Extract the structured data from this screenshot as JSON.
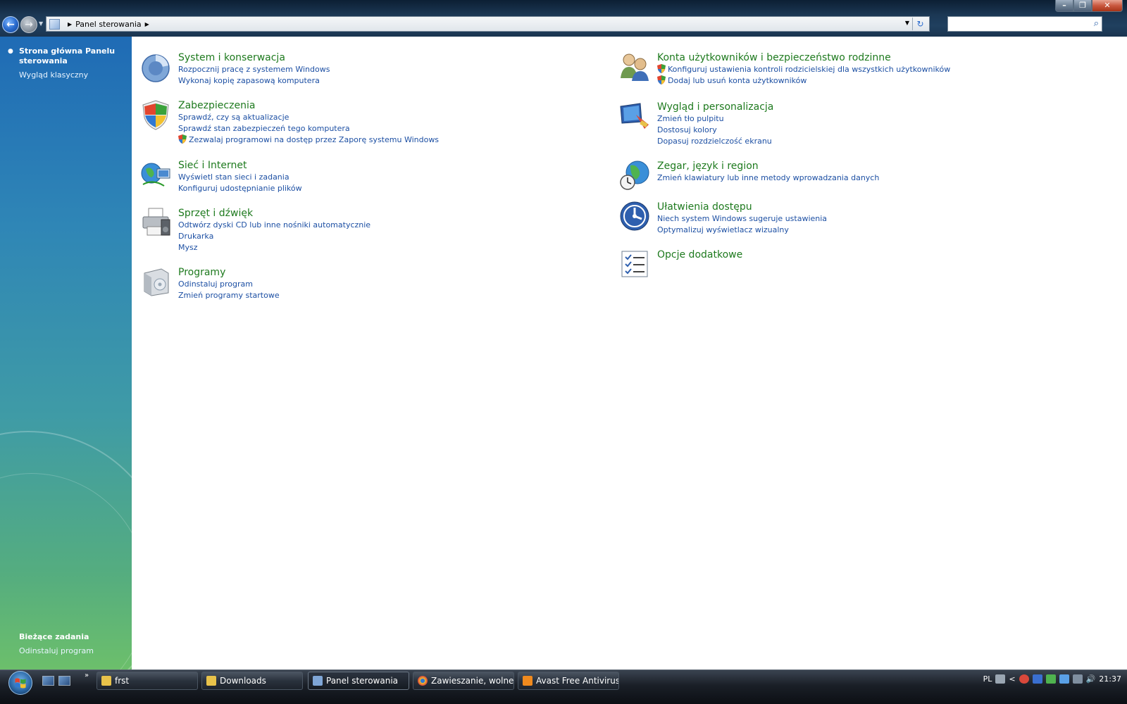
{
  "window": {
    "controls": {
      "minimize": "–",
      "maximize": "❐",
      "close": "✕"
    }
  },
  "addressbar": {
    "crumb": "Panel sterowania",
    "search_placeholder": ""
  },
  "leftpane": {
    "home_link": "Strona główna Panelu sterowania",
    "classic_link": "Wygląd klasyczny",
    "tasks_title": "Bieżące zadania",
    "tasks_link": "Odinstaluj program"
  },
  "categories": {
    "system": {
      "title": "System i konserwacja",
      "links": [
        "Rozpocznij pracę z systemem Windows",
        "Wykonaj kopię zapasową komputera"
      ]
    },
    "security": {
      "title": "Zabezpieczenia",
      "links": [
        "Sprawdź, czy są aktualizacje",
        "Sprawdź stan zabezpieczeń tego komputera",
        "Zezwalaj programowi na dostęp przez Zaporę systemu Windows"
      ]
    },
    "network": {
      "title": "Sieć i Internet",
      "links": [
        "Wyświetl stan sieci i zadania",
        "Konfiguruj udostępnianie plików"
      ]
    },
    "hardware": {
      "title": "Sprzęt i dźwięk",
      "links": [
        "Odtwórz dyski CD lub inne nośniki automatycznie",
        "Drukarka",
        "Mysz"
      ]
    },
    "programs": {
      "title": "Programy",
      "links": [
        "Odinstaluj program",
        "Zmień programy startowe"
      ]
    },
    "users": {
      "title": "Konta użytkowników i bezpieczeństwo rodzinne",
      "links": [
        "Konfiguruj ustawienia kontroli rodzicielskiej dla wszystkich użytkowników",
        "Dodaj lub usuń konta użytkowników"
      ]
    },
    "appearance": {
      "title": "Wygląd i personalizacja",
      "links": [
        "Zmień tło pulpitu",
        "Dostosuj kolory",
        "Dopasuj rozdzielczość ekranu"
      ]
    },
    "clock": {
      "title": "Zegar, język i region",
      "links": [
        "Zmień klawiatury lub inne metody wprowadzania danych"
      ]
    },
    "access": {
      "title": "Ułatwienia dostępu",
      "links": [
        "Niech system Windows sugeruje ustawienia",
        "Optymalizuj wyświetlacz wizualny"
      ]
    },
    "additional": {
      "title": "Opcje dodatkowe"
    }
  },
  "taskbar": {
    "quicklaunch_more": "»",
    "tasks": [
      {
        "label": "frst",
        "color": "#e8c24a"
      },
      {
        "label": "Downloads",
        "color": "#e8c24a"
      },
      {
        "label": "Panel sterowania",
        "color": "#7fa6d6"
      },
      {
        "label": "Zawieszanie, wolne ...",
        "color": "#d9483b"
      },
      {
        "label": "Avast Free Antivirus",
        "color": "#f08a1e"
      }
    ],
    "tray": {
      "language": "PL",
      "collapse": "<",
      "volume": "🔊",
      "clock": "21:37"
    }
  },
  "colors": {
    "category_title": "#1e7a1e",
    "category_link": "#1c4fa3"
  }
}
